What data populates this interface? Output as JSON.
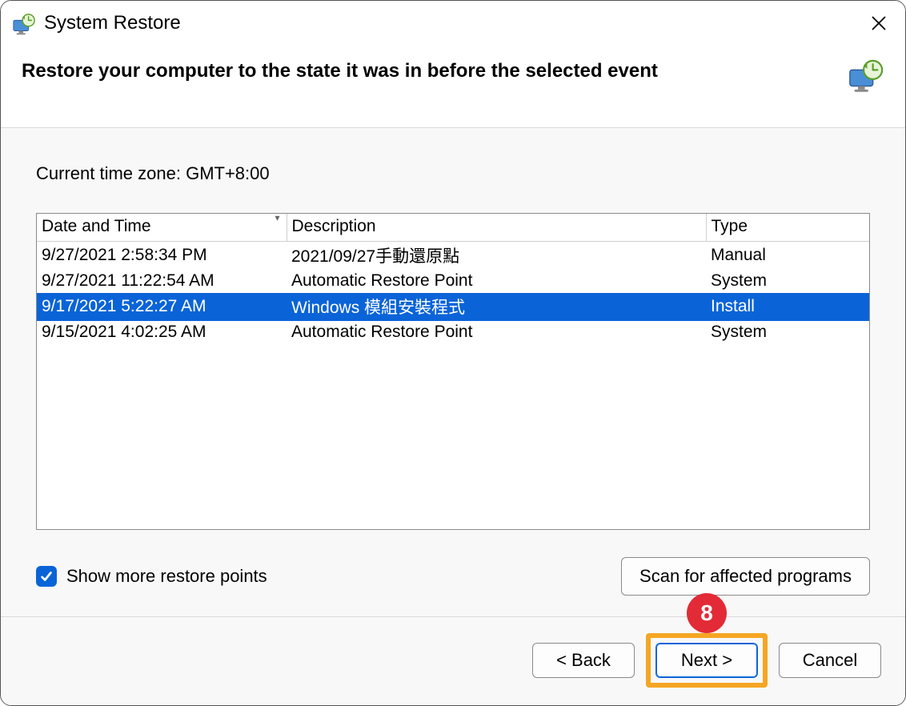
{
  "title": "System Restore",
  "heading": "Restore your computer to the state it was in before the selected event",
  "timezone_label": "Current time zone: GMT+8:00",
  "columns": {
    "date": "Date and Time",
    "desc": "Description",
    "type": "Type"
  },
  "rows": [
    {
      "date": "9/27/2021 2:58:34 PM",
      "desc": "2021/09/27手動還原點",
      "type": "Manual",
      "selected": false
    },
    {
      "date": "9/27/2021 11:22:54 AM",
      "desc": "Automatic Restore Point",
      "type": "System",
      "selected": false
    },
    {
      "date": "9/17/2021 5:22:27 AM",
      "desc": "Windows 模組安裝程式",
      "type": "Install",
      "selected": true
    },
    {
      "date": "9/15/2021 4:02:25 AM",
      "desc": "Automatic Restore Point",
      "type": "System",
      "selected": false
    }
  ],
  "show_more_label": "Show more restore points",
  "show_more_checked": true,
  "scan_button": "Scan for affected programs",
  "buttons": {
    "back": "< Back",
    "next": "Next >",
    "cancel": "Cancel"
  },
  "annotation_step": "8"
}
